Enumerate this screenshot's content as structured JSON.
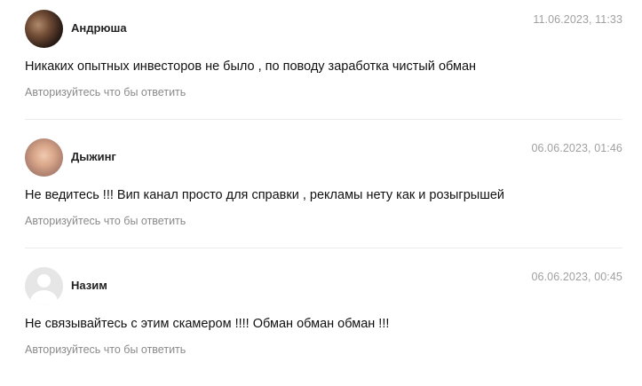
{
  "comments": [
    {
      "author": "Андрюша",
      "date": "11.06.2023, 11:33",
      "text": "Никаких опытных инвесторов не было , по поводу заработка чистый обман",
      "reply_link": "Авторизуйтесь что бы ответить",
      "avatar": "photo-avatar-dark"
    },
    {
      "author": "Дыжинг",
      "date": "06.06.2023, 01:46",
      "text": "Не ведитесь !!! Вип канал просто для справки , рекламы нету как и розыгрышей",
      "reply_link": "Авторизуйтесь что бы ответить",
      "avatar": "photo-avatar-light"
    },
    {
      "author": "Назим",
      "date": "06.06.2023, 00:45",
      "text": "Не связывайтесь с этим скамером !!!! Обман обман обман !!!",
      "reply_link": "Авторизуйтесь что бы ответить",
      "avatar": "default-user-avatar"
    }
  ]
}
